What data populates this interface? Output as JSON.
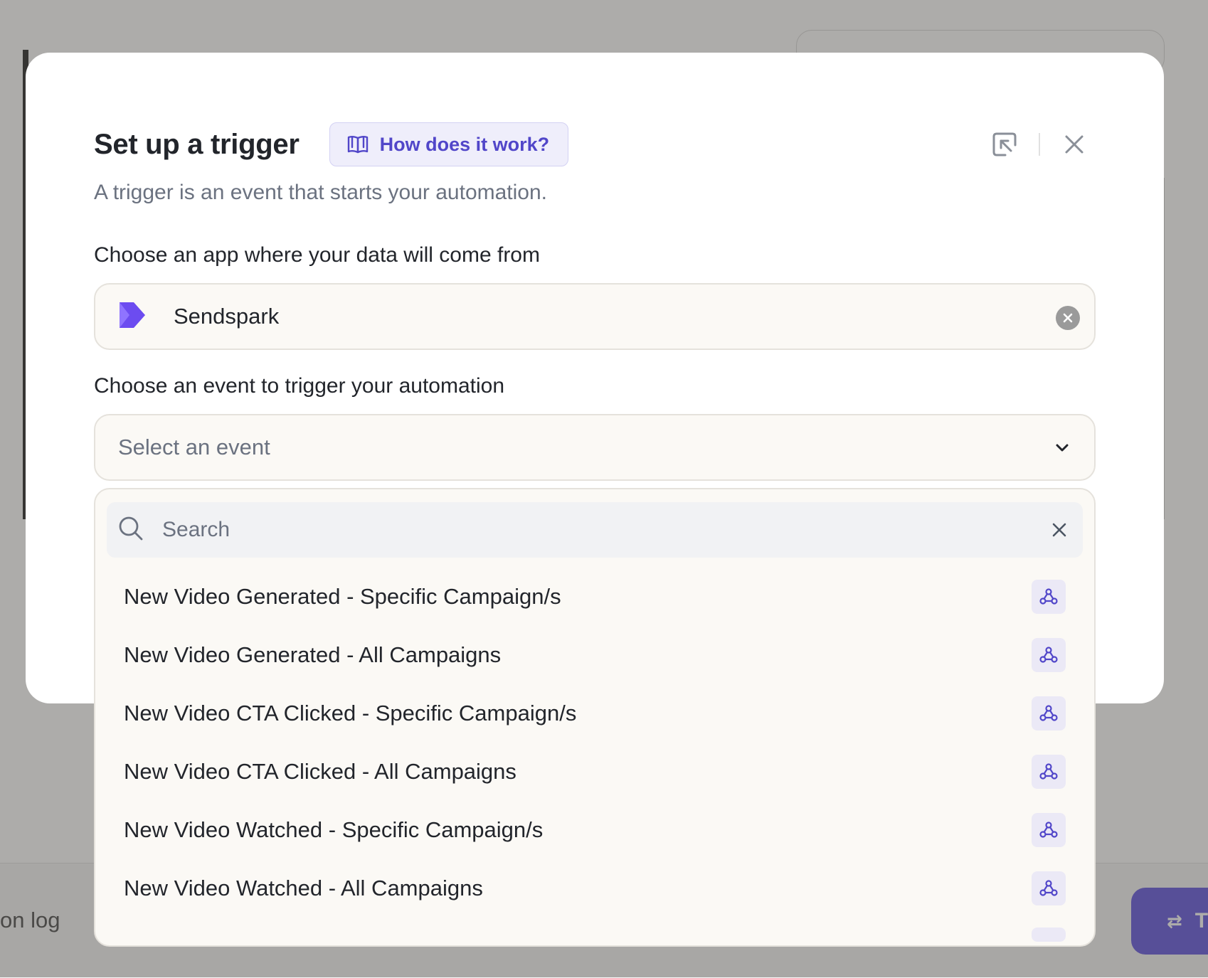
{
  "background": {
    "log_link_label": "on log",
    "test_button_label": "T",
    "test_button_icon": "swap-arrows-icon"
  },
  "modal": {
    "title": "Set up a trigger",
    "help_button_label": "How does it work?",
    "help_icon": "book-icon",
    "subtitle": "A trigger is an event that starts your automation.",
    "app_field": {
      "label": "Choose an app where your data will come from",
      "value": "Sendspark",
      "logo": "sendspark-logo"
    },
    "event_field": {
      "label": "Choose an event to trigger your automation",
      "placeholder": "Select an event"
    },
    "dropdown": {
      "search_placeholder": "Search",
      "options": [
        {
          "label": "New Video Generated - Specific Campaign/s",
          "icon": "webhook-icon"
        },
        {
          "label": "New Video Generated - All Campaigns",
          "icon": "webhook-icon"
        },
        {
          "label": "New Video CTA Clicked - Specific Campaign/s",
          "icon": "webhook-icon"
        },
        {
          "label": "New Video CTA Clicked - All Campaigns",
          "icon": "webhook-icon"
        },
        {
          "label": "New Video Watched - Specific Campaign/s",
          "icon": "webhook-icon"
        },
        {
          "label": "New Video Watched - All Campaigns",
          "icon": "webhook-icon"
        }
      ]
    }
  },
  "colors": {
    "accent": "#5146c9",
    "help_button_bg": "#efeefb",
    "field_bg": "#fbf9f5",
    "overlay": "#3c3a34",
    "test_button": "#6b5fe0"
  }
}
